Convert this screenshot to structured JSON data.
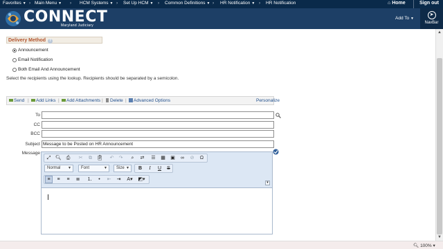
{
  "topnav": {
    "favorites": "Favorites",
    "main_menu": "Main Menu",
    "breadcrumb": [
      "HCM Systems",
      "Set Up HCM",
      "Common Definitions",
      "HR Notification",
      "HR Notification"
    ],
    "home": "Home",
    "sign_out": "Sign out"
  },
  "banner": {
    "logo_text": "CONNECT",
    "logo_sub": "Maryland Judiciary",
    "add_to": "Add To",
    "navbar": "NavBar"
  },
  "delivery": {
    "label": "Delivery Method",
    "options": [
      "Announcement",
      "Email Notification",
      "Both Email And Announcement"
    ],
    "selected": "Announcement"
  },
  "instructions": "Select the recipients using the lookup. Recipients should be separated by a semicolon.",
  "actions": {
    "send": "Send",
    "add_links": "Add Links",
    "add_attachments": "Add Attachments",
    "delete": "Delete",
    "advanced_options": "Advanced Options",
    "personalize": "Personalize"
  },
  "fields": {
    "to_label": "To",
    "cc_label": "CC",
    "bcc_label": "BCC",
    "subject_label": "Subject",
    "subject_value": "Message to be Posted on HR Announcement",
    "message_label": "Message"
  },
  "editor": {
    "format": "Normal",
    "font": "Font",
    "size": "Size"
  },
  "status": {
    "zoom": "100%"
  },
  "colors": {
    "topnav_bg": "#0a2a4a",
    "banner_bg": "#1d3f66",
    "section_label": "#b0522a",
    "link": "#1f4e8c"
  }
}
